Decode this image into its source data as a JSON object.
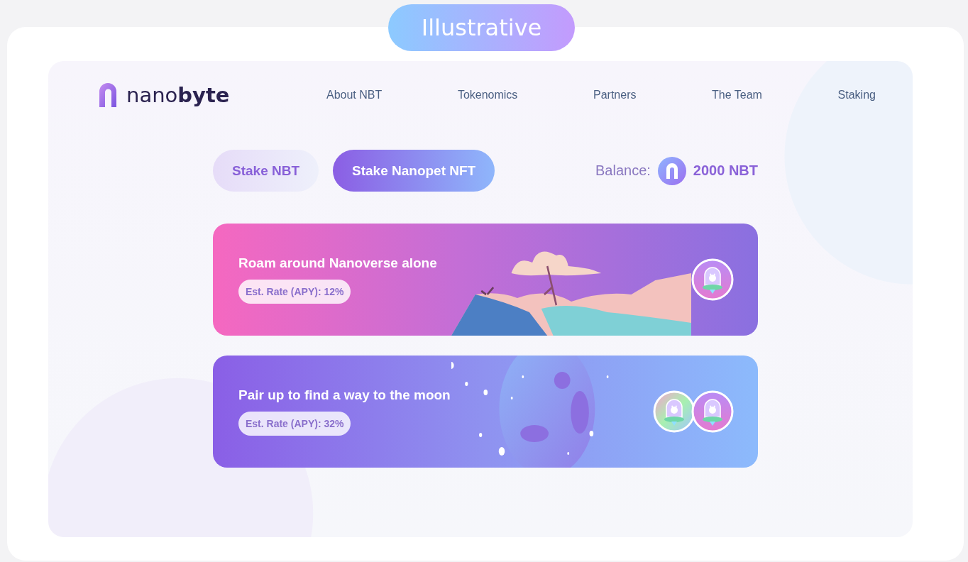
{
  "badge": "Illustrative",
  "logo": "nano**byte**",
  "nav": [
    "About NBT",
    "Tokenomics",
    "Partners",
    "The Team",
    "Staking"
  ],
  "tabs": [
    {
      "label": "Stake NBT",
      "selected": false
    },
    {
      "label": "Stake Nanopet NFT",
      "selected": true
    }
  ],
  "balance": {
    "label": "Balance:",
    "amount": "2000 NBT"
  },
  "pools": [
    {
      "kind": "landscape",
      "title": "Roam around Nanoverse alone",
      "rate": "Est. Rate (APY): 12%"
    },
    {
      "kind": "moon",
      "title": "Pair up to find a way to the moon",
      "rate": "Est. Rate (APY): 32%"
    }
  ]
}
